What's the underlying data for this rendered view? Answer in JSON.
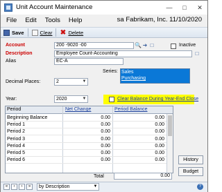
{
  "window": {
    "title": "Unit Account Maintenance",
    "company_info": "sa  Fabrikam, Inc.  11/10/2020"
  },
  "menu": [
    "File",
    "Edit",
    "Tools",
    "Help"
  ],
  "toolbar": {
    "save_label": "Save",
    "clear_label": "Clear",
    "delete_label": "Delete"
  },
  "form": {
    "account_label": "Account",
    "account_value": "200 -9020 -00",
    "inactive_label": "Inactive",
    "description_label": "Description",
    "description_value": "Employee Count-Accounting",
    "alias_label": "Alias",
    "alias_value": "EC-A",
    "series_label": "Series:",
    "series_options": [
      "Sales",
      "Purchasing"
    ],
    "decimal_places_label": "Decimal Places:",
    "decimal_places_value": "2",
    "year_label": "Year:",
    "year_value": "2020",
    "clear_balance_label": "Clear Balance During Year-End Close"
  },
  "grid": {
    "headers": {
      "period": "Period",
      "net_change": "Net Change",
      "period_balance": "Period Balance"
    },
    "rows": [
      {
        "period": "Beginning Balance",
        "net_change": "0.00",
        "balance": "0.00"
      },
      {
        "period": "Period 1",
        "net_change": "0.00",
        "balance": "0.00"
      },
      {
        "period": "Period 2",
        "net_change": "0.00",
        "balance": "0.00"
      },
      {
        "period": "Period 3",
        "net_change": "0.00",
        "balance": "0.00"
      },
      {
        "period": "Period 4",
        "net_change": "0.00",
        "balance": "0.00"
      },
      {
        "period": "Period 5",
        "net_change": "0.00",
        "balance": "0.00"
      },
      {
        "period": "Period 6",
        "net_change": "0.00",
        "balance": "0.00"
      }
    ],
    "total_label": "Total",
    "total_value": "0.00"
  },
  "side_buttons": {
    "history": "History",
    "budget": "Budget"
  },
  "status": {
    "browse_value": "by Description"
  },
  "colors": {
    "highlight": "#ffff00",
    "required_label": "#cc0000",
    "link": "#1a3f9c",
    "list_selection": "#0a78d7"
  }
}
